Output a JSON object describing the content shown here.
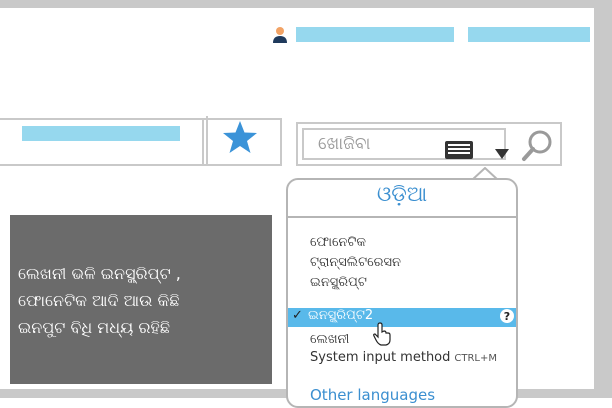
{
  "header": {
    "user_icon": "user-icon"
  },
  "search": {
    "placeholder": "ଖୋଜିବା",
    "keyboard_icon": "keyboard-icon",
    "search_icon": "search-icon"
  },
  "nav": {
    "star_icon": "star-icon"
  },
  "ime_menu": {
    "title": "ଓଡ଼ିଆ",
    "items": [
      {
        "label": "ଫୋନେଟିକ"
      },
      {
        "label": "ଟ୍ରାନ୍ସଲିଟରେସନ"
      },
      {
        "label": "ଇନସ୍କ୍ରିପ୍ଟ"
      },
      {
        "label": "ଇନସ୍କ୍ରିପ୍ଟ2",
        "selected": true
      },
      {
        "label": "ଲେଖନୀ"
      }
    ],
    "system_input": "System input method",
    "system_shortcut": "CTRL+M",
    "other_languages": "Other languages",
    "check_mark": "✓",
    "help_icon": "help-icon"
  },
  "callout": {
    "lines": [
      "ଲେଖନୀ ଭଳି ଇନସ୍କ୍ରିପ୍ଟ ,",
      "ଫୋନେଟିକ ଆଦି ଆଉ କିଛି",
      "ଇନପୁଟ ବିଧି ମଧ୍ୟ ରହିଛି"
    ]
  },
  "colors": {
    "accent": "#96d8ee",
    "frame": "#c9c9c9",
    "selected": "#59b9ea",
    "callout_bg": "#6b6b6b",
    "title_blue": "#3b8fd0"
  }
}
